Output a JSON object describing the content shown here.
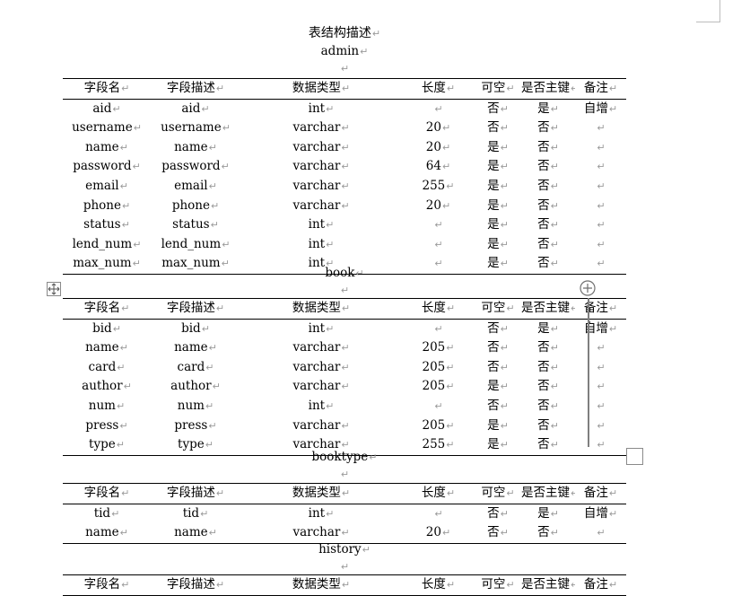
{
  "doc": {
    "title": "表结构描述",
    "paragraph_mark": "↵",
    "headers": [
      "字段名",
      "字段描述",
      "数据类型",
      "长度",
      "可空",
      "是否主键",
      "备注"
    ]
  },
  "tables": [
    {
      "name": "admin",
      "rows": [
        [
          "aid",
          "aid",
          "int",
          "",
          "否",
          "是",
          "自增"
        ],
        [
          "username",
          "username",
          "varchar",
          "20",
          "否",
          "否",
          ""
        ],
        [
          "name",
          "name",
          "varchar",
          "20",
          "是",
          "否",
          ""
        ],
        [
          "password",
          "password",
          "varchar",
          "64",
          "是",
          "否",
          ""
        ],
        [
          "email",
          "email",
          "varchar",
          "255",
          "是",
          "否",
          ""
        ],
        [
          "phone",
          "phone",
          "varchar",
          "20",
          "是",
          "否",
          ""
        ],
        [
          "status",
          "status",
          "int",
          "",
          "是",
          "否",
          ""
        ],
        [
          "lend_num",
          "lend_num",
          "int",
          "",
          "是",
          "否",
          ""
        ],
        [
          "max_num",
          "max_num",
          "int",
          "",
          "是",
          "否",
          ""
        ]
      ]
    },
    {
      "name": "book",
      "rows": [
        [
          "bid",
          "bid",
          "int",
          "",
          "否",
          "是",
          "自增"
        ],
        [
          "name",
          "name",
          "varchar",
          "205",
          "否",
          "否",
          ""
        ],
        [
          "card",
          "card",
          "varchar",
          "205",
          "否",
          "否",
          ""
        ],
        [
          "author",
          "author",
          "varchar",
          "205",
          "是",
          "否",
          ""
        ],
        [
          "num",
          "num",
          "int",
          "",
          "否",
          "否",
          ""
        ],
        [
          "press",
          "press",
          "varchar",
          "205",
          "是",
          "否",
          ""
        ],
        [
          "type",
          "type",
          "varchar",
          "255",
          "是",
          "否",
          ""
        ]
      ]
    },
    {
      "name": "booktype",
      "rows": [
        [
          "tid",
          "tid",
          "int",
          "",
          "否",
          "是",
          "自增"
        ],
        [
          "name",
          "name",
          "varchar",
          "20",
          "否",
          "否",
          ""
        ]
      ]
    },
    {
      "name": "history",
      "rows": []
    }
  ]
}
